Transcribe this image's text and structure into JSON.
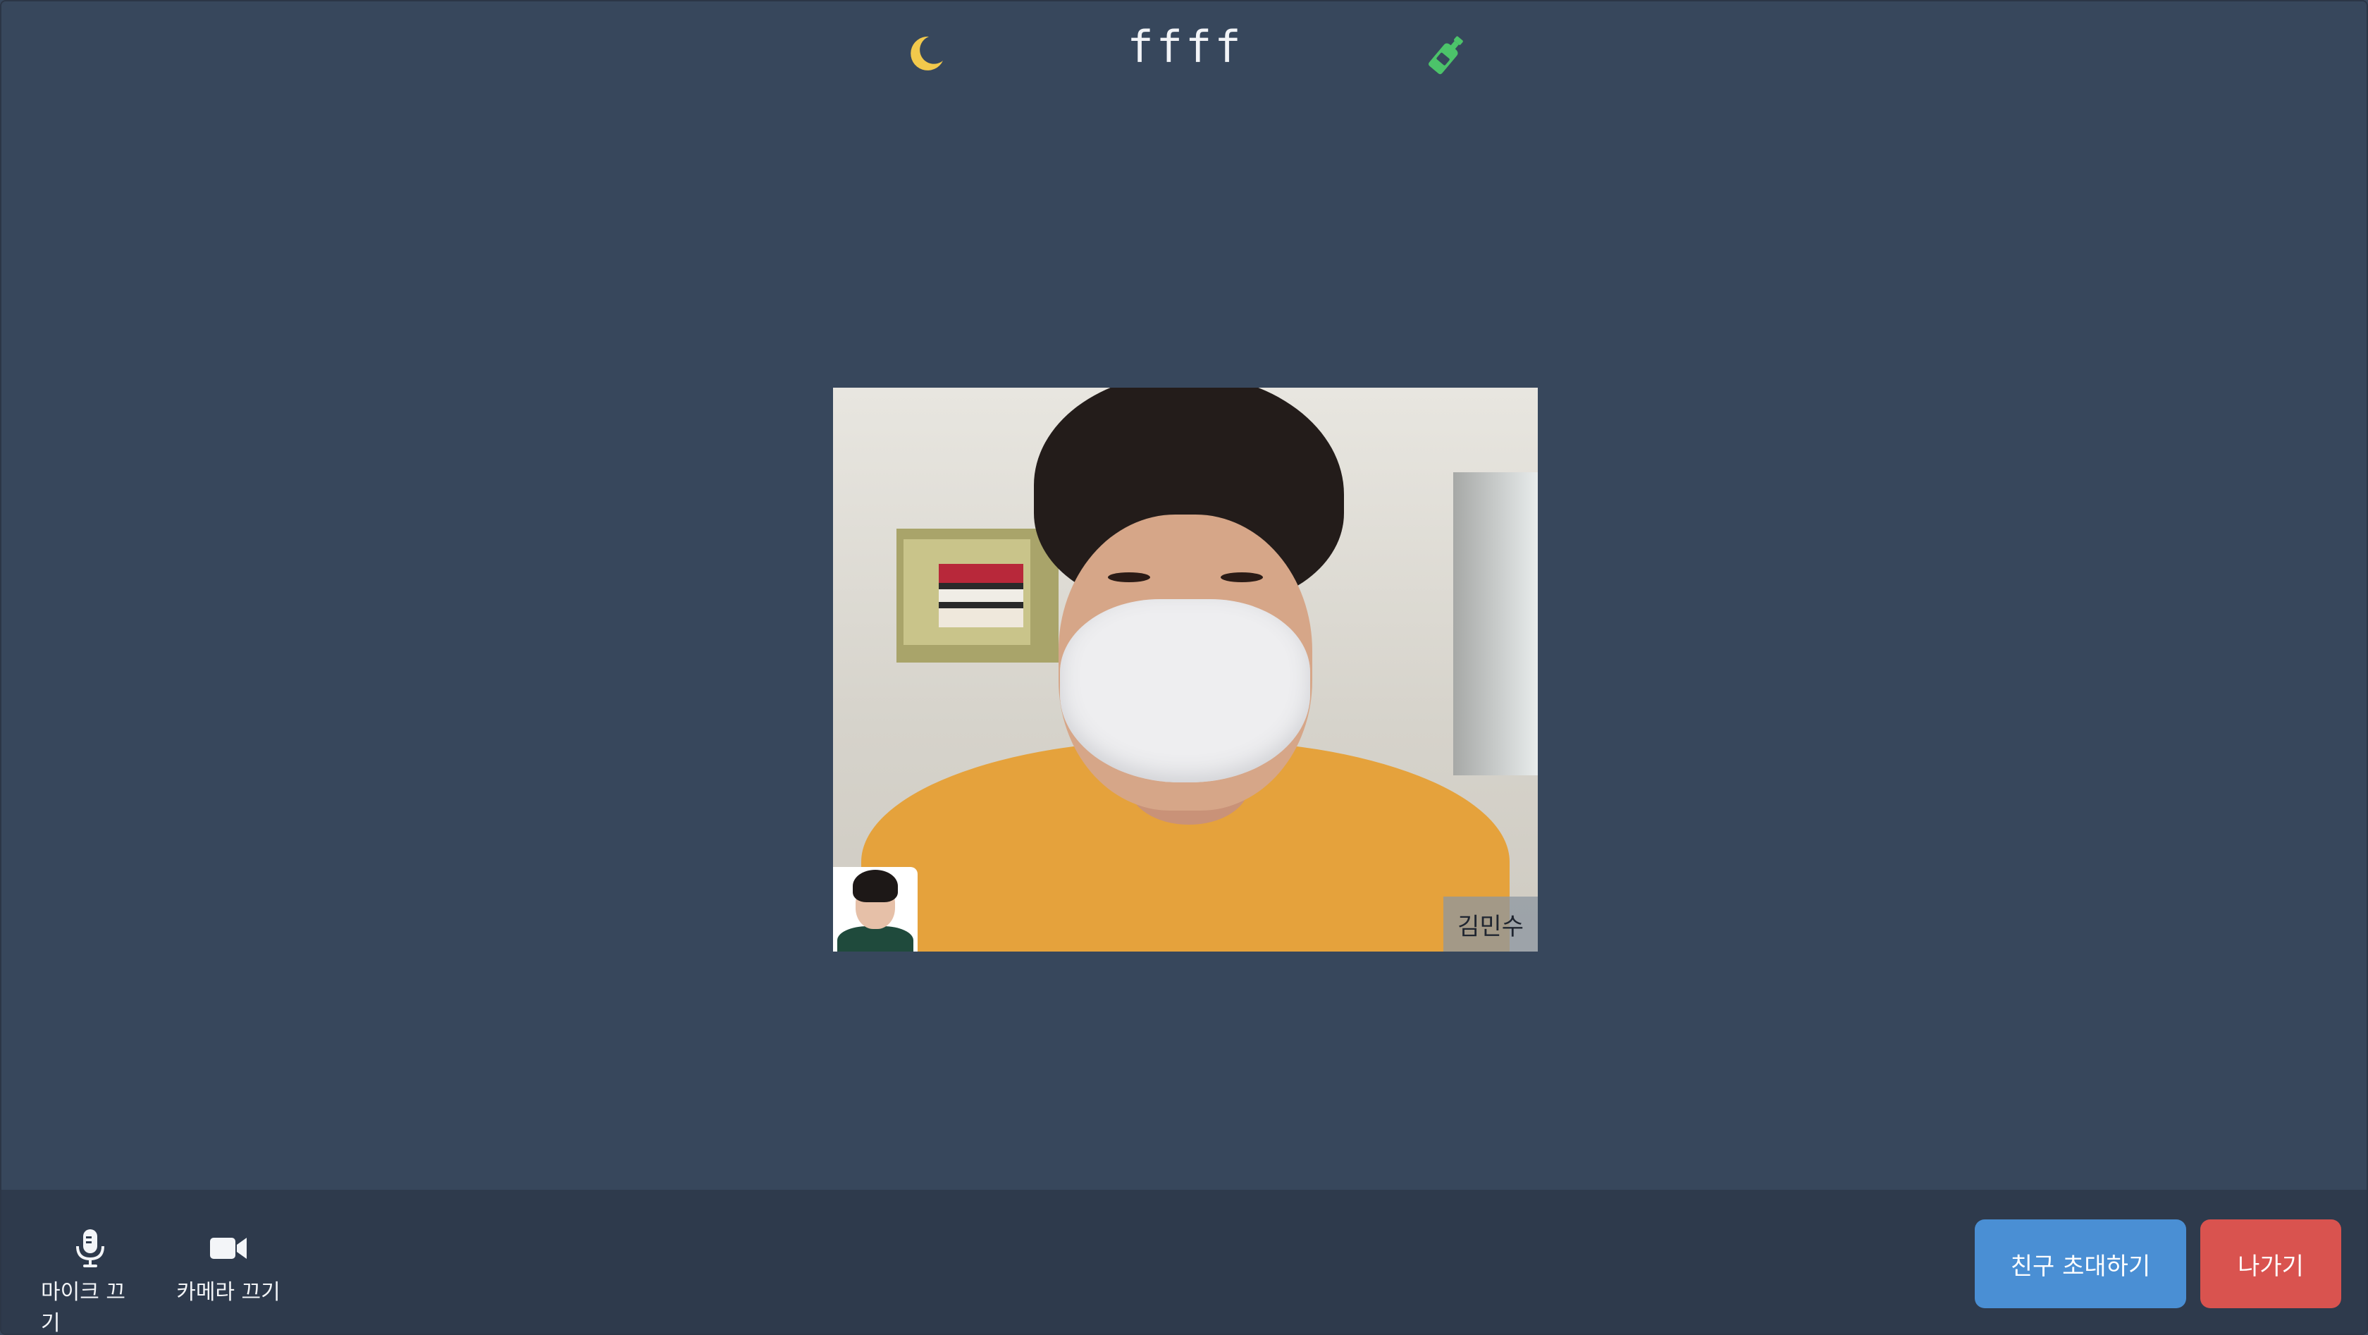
{
  "header": {
    "moon_icon": "moon-icon",
    "room_title": "ffff",
    "bottle_icon": "bottle-icon"
  },
  "video": {
    "participant_name": "김민수"
  },
  "controls": {
    "mic_label": "마이크 끄기",
    "mic_icon": "microphone-icon",
    "camera_label": "카메라 끄기",
    "camera_icon": "video-camera-icon",
    "invite_label": "친구 초대하기",
    "leave_label": "나가기"
  },
  "colors": {
    "background": "#37475c",
    "bottom_bar": "#2e3a4c",
    "moon": "#f2c94c",
    "bottle": "#4cc36a",
    "invite": "#4a8fd4",
    "leave": "#d9534f"
  }
}
